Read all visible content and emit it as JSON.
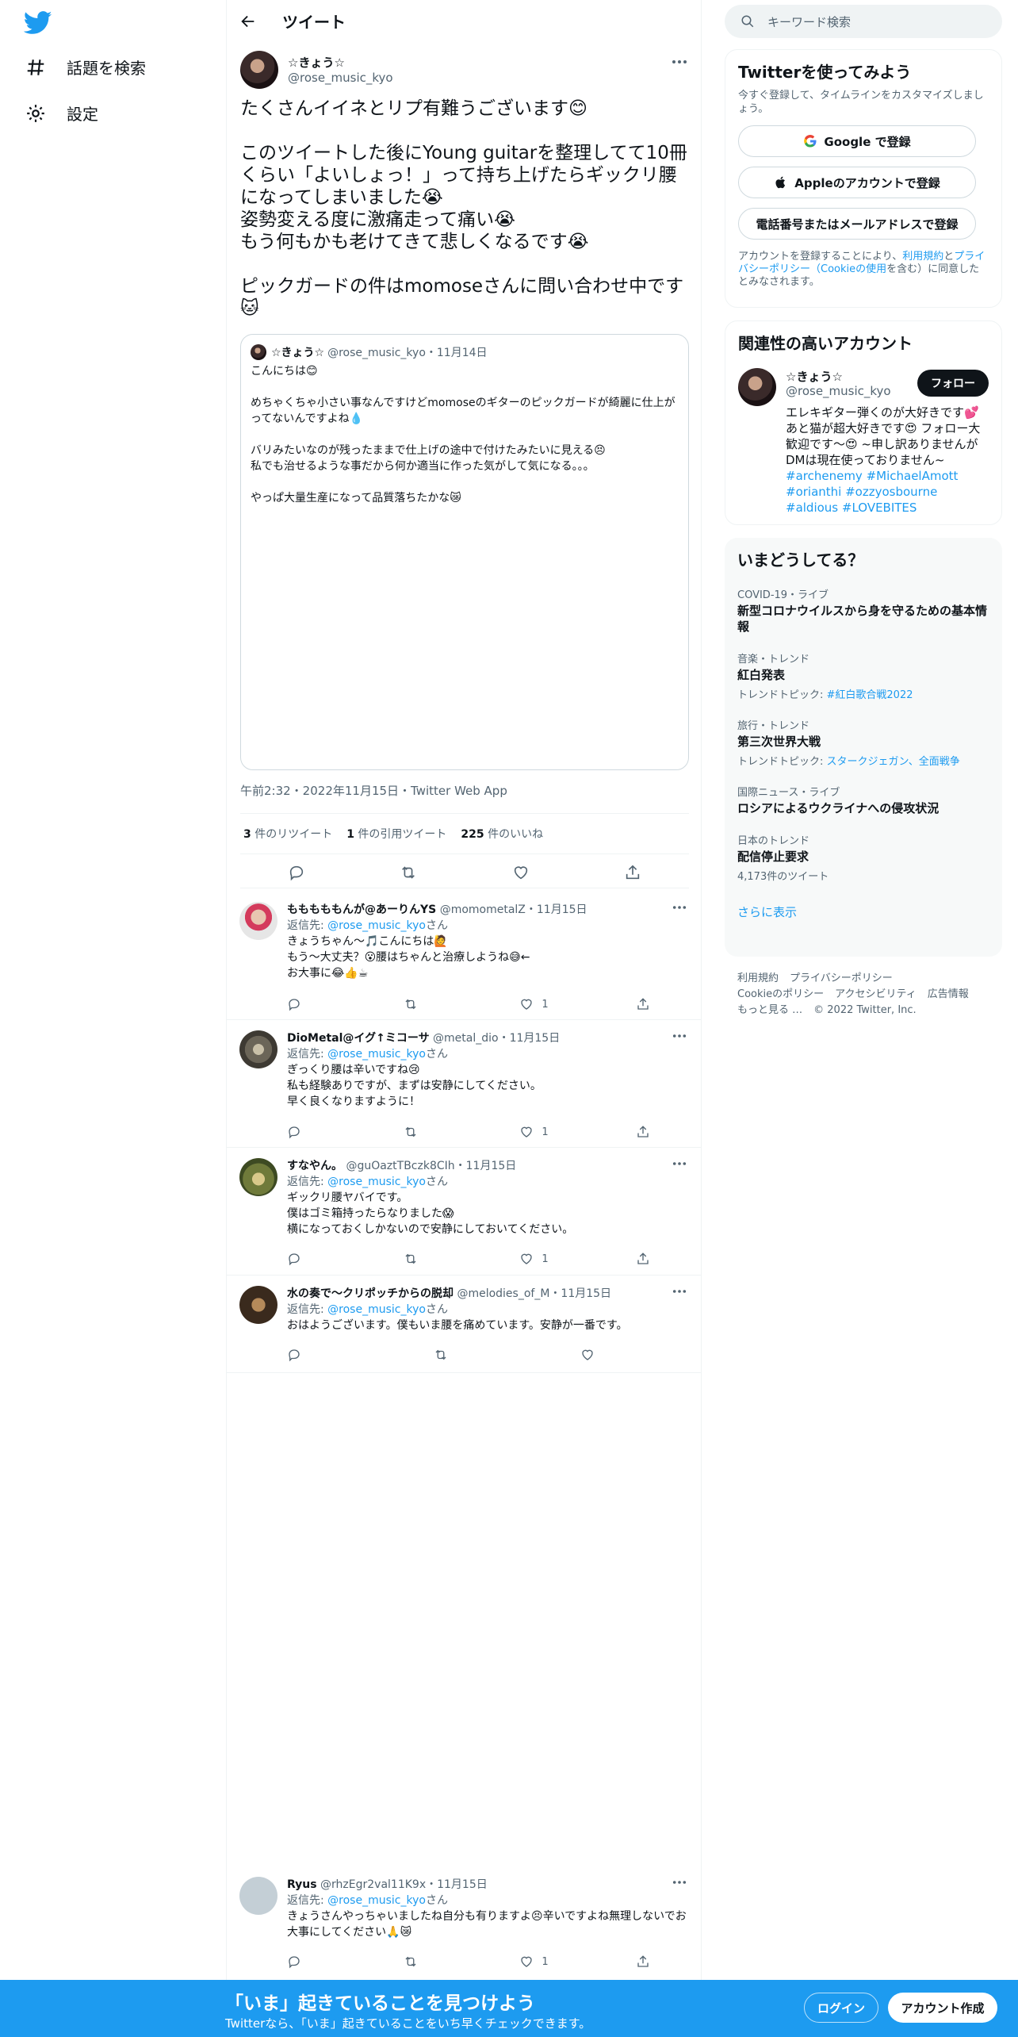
{
  "nav": {
    "explore_label": "話題を検索",
    "settings_label": "設定"
  },
  "header": {
    "title": "ツイート"
  },
  "tweet": {
    "name": "☆きょう☆",
    "handle": "@rose_music_kyo",
    "text": "たくさんイイネとリプ有難うございます😊\n\nこのツイートした後にYoung guitarを整理してて10冊くらい「よいしょっ！」って持ち上げたらギックリ腰になってしまいました😭\n姿勢変える度に激痛走って痛い😭\nもう何もかも老けてきて悲しくなるです😭\n\nピックガードの件はmomoseさんに問い合わせ中です🐱",
    "meta": "午前2:32・2022年11月15日・Twitter Web App",
    "retweets_count": "3",
    "retweets_label": "件のリツイート",
    "quotes_count": "1",
    "quotes_label": "件の引用ツイート",
    "likes_count": "225",
    "likes_label": "件のいいね"
  },
  "quote": {
    "name": "☆きょう☆",
    "handle_date": "@rose_music_kyo・11月14日",
    "text": "こんにちは😊\n\nめちゃくちゃ小さい事なんですけどmomoseのギターのピックガードが綺麗に仕上がってないんですよね💧\n\nバリみたいなのが残ったままで仕上げの途中で付けたみたいに見える😣\n私でも治せるような事だから何か適当に作った気がして気になる。。。\n\nやっぱ大量生産になって品質落ちたかな😿"
  },
  "replies": [
    {
      "name": "もももももんが@あーりんYS",
      "handle_date": "@momometalZ・11月15日",
      "reply_to_prefix": "返信先: ",
      "reply_to_handle": "@rose_music_kyo",
      "reply_to_suffix": "さん",
      "text": "きょうちゃん〜🎵こんにちは🙋\nもう〜大丈夫？😮腰はちゃんと治療しようね😅←\nお大事に😂👍☕",
      "likes": "1"
    },
    {
      "name": "DioMetal@イグ↑ミコーサ",
      "handle_date": "@metal_dio・11月15日",
      "reply_to_prefix": "返信先: ",
      "reply_to_handle": "@rose_music_kyo",
      "reply_to_suffix": "さん",
      "text": "ぎっくり腰は辛いですね😢\n私も経験ありですが、まずは安静にしてください。\n早く良くなりますように！",
      "likes": "1"
    },
    {
      "name": "すなやん。",
      "handle_date": "@guOaztTBczk8CIh・11月15日",
      "reply_to_prefix": "返信先: ",
      "reply_to_handle": "@rose_music_kyo",
      "reply_to_suffix": "さん",
      "text": "ギックリ腰ヤバイです。\n僕はゴミ箱持ったらなりました😱\n横になっておくしかないので安静にしておいてください。",
      "likes": "1"
    },
    {
      "name": "水の奏で〜クリポッチからの脱却",
      "handle_date": "@melodies_of_M・11月15日",
      "reply_to_prefix": "返信先: ",
      "reply_to_handle": "@rose_music_kyo",
      "reply_to_suffix": "さん",
      "text": "おはようございます。僕もいま腰を痛めています。安静が一番です。",
      "likes": ""
    },
    {
      "name": "Ryus",
      "handle_date": "@rhzEgr2val11K9x・11月15日",
      "reply_to_prefix": "返信先: ",
      "reply_to_handle": "@rose_music_kyo",
      "reply_to_suffix": "さん",
      "text": "きょうさんやっちゃいましたね自分も有りますよ😣辛いですよね無理しないでお大事にしてください🙏😿",
      "likes": "1"
    }
  ],
  "sidebar": {
    "search_placeholder": "キーワード検索",
    "signup": {
      "title": "Twitterを使ってみよう",
      "subtitle": "今すぐ登録して、タイムラインをカスタマイズしましょう。",
      "google_label": "Google で登録",
      "apple_label": "Appleのアカウントで登録",
      "phone_label": "電話番号またはメールアドレスで登録",
      "legal_prefix": "アカウントを登録することにより、",
      "legal_terms": "利用規約",
      "legal_and": "と",
      "legal_privacy": "プライバシーポリシー（Cookieの使用",
      "legal_suffix": "を含む）に同意したとみなされます。"
    },
    "related": {
      "title": "関連性の高いアカウント",
      "name": "☆きょう☆",
      "handle": "@rose_music_kyo",
      "follow_label": "フォロー",
      "bio": "エレキギター弾くのが大好きです💕あと猫が超大好きです😍 フォロー大歓迎です〜😍 ~申し訳ありませんがDMは現在使っておりません~",
      "tags": "#archenemy #MichaelAmott #orianthi #ozzyosbourne #aldious #LOVEBITES"
    },
    "trends": {
      "title": "いまどうしてる？",
      "items": [
        {
          "context": "COVID-19・ライブ",
          "title": "新型コロナウイルスから身を守るための基本情報",
          "sub": ""
        },
        {
          "context": "音楽・トレンド",
          "title": "紅白発表",
          "sub_prefix": "トレンドトピック: ",
          "sub_link": "#紅白歌合戦2022"
        },
        {
          "context": "旅行・トレンド",
          "title": "第三次世界大戦",
          "sub_prefix": "トレンドトピック: ",
          "sub_link": "スタークジェガン、全面戦争"
        },
        {
          "context": "国際ニュース・ライブ",
          "title": "ロシアによるウクライナへの侵攻状況",
          "sub": ""
        },
        {
          "context": "日本のトレンド",
          "title": "配信停止要求",
          "sub": "4,173件のツイート"
        }
      ],
      "more_label": "さらに表示"
    },
    "footer": {
      "terms": "利用規約",
      "privacy": "プライバシーポリシー",
      "cookie": "Cookieのポリシー",
      "accessibility": "アクセシビリティ",
      "ads": "広告情報",
      "more": "もっと見る …",
      "copyright": "© 2022 Twitter, Inc."
    }
  },
  "bottombar": {
    "title": "「いま」起きていることを見つけよう",
    "subtitle": "Twitterなら、「いま」起きていることをいち早くチェックできます。",
    "login_label": "ログイン",
    "signup_label": "アカウント作成"
  },
  "colors": {
    "accent": "#1d9bf0",
    "text": "#0f1419",
    "secondary": "#536471"
  }
}
